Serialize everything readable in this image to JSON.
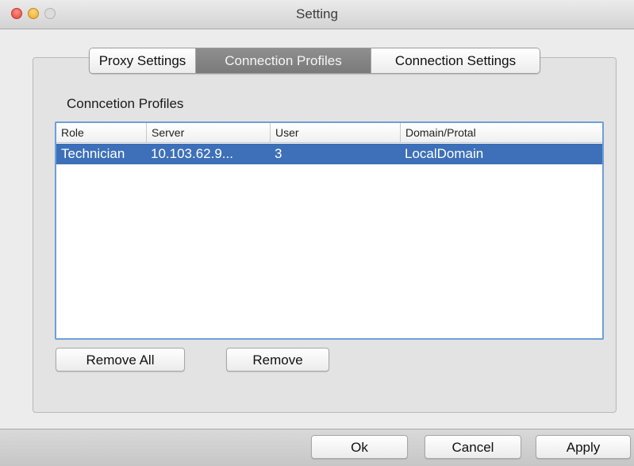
{
  "window": {
    "title": "Setting"
  },
  "tabs": [
    {
      "label": "Proxy Settings",
      "selected": false
    },
    {
      "label": "Connection Profiles",
      "selected": true
    },
    {
      "label": "Connection Settings",
      "selected": false
    }
  ],
  "profiles": {
    "section_label": "Conncetion Profiles",
    "columns": [
      "Role",
      "Server",
      "User",
      "Domain/Protal"
    ],
    "rows": [
      {
        "role": "Technician",
        "server": "10.103.62.9...",
        "user": "3",
        "domain": "LocalDomain",
        "selected": true
      }
    ],
    "remove_all_label": "Remove All",
    "remove_label": "Remove"
  },
  "footer": {
    "ok_label": "Ok",
    "cancel_label": "Cancel",
    "apply_label": "Apply"
  },
  "colors": {
    "selection": "#3d70b8",
    "table_border": "#6f9fd7",
    "selected_tab": "#858585"
  }
}
